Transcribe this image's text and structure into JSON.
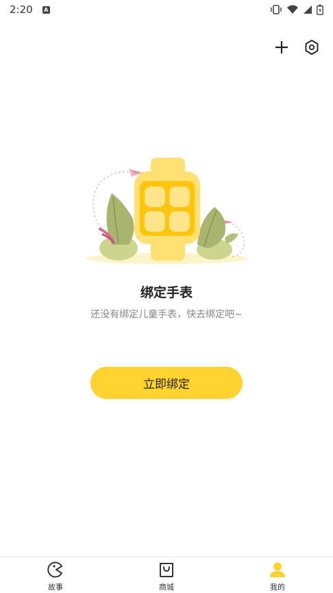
{
  "status_bar": {
    "time": "2:20",
    "badge": "A"
  },
  "header": {
    "add_icon": "plus-icon",
    "settings_icon": "hexagon-settings-icon"
  },
  "empty_state": {
    "title": "绑定手表",
    "subtitle": "还没有绑定儿童手表，快去绑定吧~",
    "button_label": "立即绑定"
  },
  "bottom_nav": {
    "items": [
      {
        "label": "故事",
        "icon": "pacman-icon"
      },
      {
        "label": "商城",
        "icon": "shopping-bag-icon"
      },
      {
        "label": "我的",
        "icon": "user-icon"
      }
    ],
    "active_index": 2
  },
  "colors": {
    "accent": "#ffd22f",
    "watch_body": "#ffe070",
    "watch_screen": "#ffc40c",
    "leaf_green": "#b5c27a",
    "leaf_dark": "#8fa05c",
    "text_primary": "#222222",
    "text_secondary": "#888888"
  }
}
